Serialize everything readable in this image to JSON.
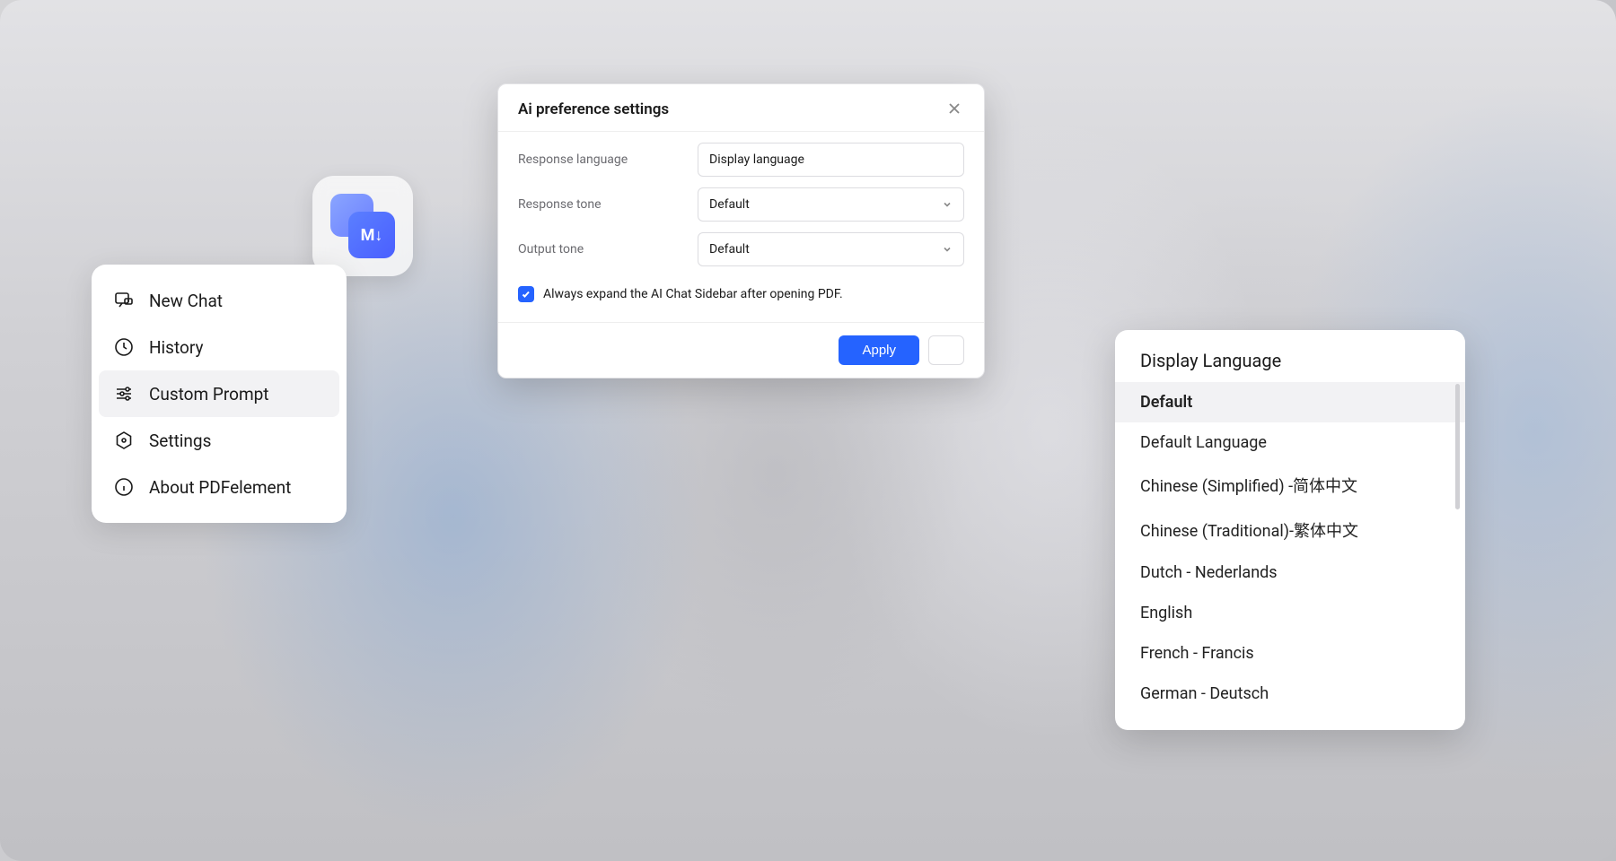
{
  "app_badge": {
    "label": "M↓"
  },
  "sidebar": {
    "items": [
      {
        "label": "New Chat"
      },
      {
        "label": "History"
      },
      {
        "label": "Custom Prompt"
      },
      {
        "label": "Settings"
      },
      {
        "label": "About PDFelement"
      }
    ],
    "active_index": 2
  },
  "settings": {
    "title": "Ai preference settings",
    "rows": [
      {
        "label": "Response language",
        "value": "Display language",
        "has_chevron": false
      },
      {
        "label": "Response tone",
        "value": "Default",
        "has_chevron": true
      },
      {
        "label": "Output tone",
        "value": "Default",
        "has_chevron": true
      }
    ],
    "checkbox": {
      "checked": true,
      "label": "Always expand the AI Chat Sidebar after opening PDF."
    },
    "apply_label": "Apply"
  },
  "language_panel": {
    "title": "Display Language",
    "selected_index": 0,
    "items": [
      "Default",
      "Default Language",
      "Chinese (Simplified) -简体中文",
      "Chinese (Traditional)-繁体中文",
      "Dutch - Nederlands",
      "English",
      "French - Francis",
      "German - Deutsch"
    ]
  },
  "colors": {
    "accent": "#2563ff",
    "background": "#d5d5d7"
  }
}
